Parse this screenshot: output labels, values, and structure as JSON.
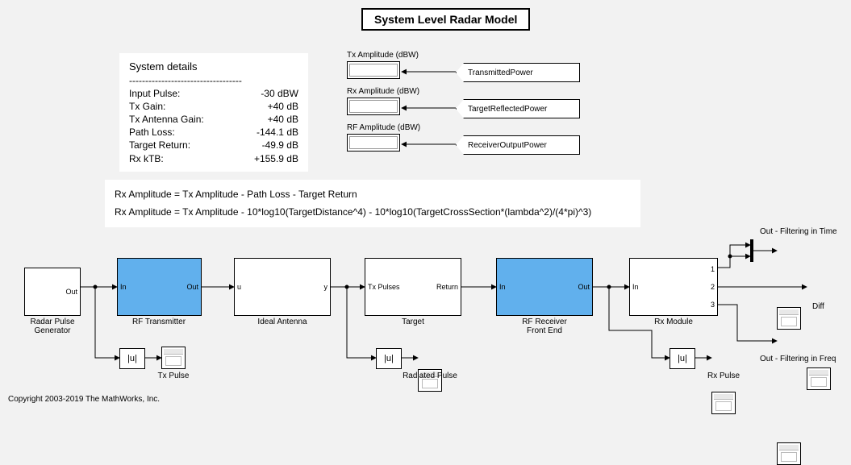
{
  "title": "System Level Radar Model",
  "details": {
    "heading": "System details",
    "dashes": "-----------------------------------",
    "rows": [
      {
        "label": "Input Pulse:",
        "value": "-30 dBW"
      },
      {
        "label": "Tx Gain:",
        "value": "+40 dB"
      },
      {
        "label": "Tx Antenna Gain:",
        "value": "+40 dB"
      },
      {
        "label": "Path Loss:",
        "value": "-144.1 dB"
      },
      {
        "label": "Target Return:",
        "value": "-49.9 dB"
      },
      {
        "label": "Rx kTB:",
        "value": "+155.9 dB"
      }
    ]
  },
  "displays": [
    {
      "label": "Tx Amplitude (dBW)",
      "from": "TransmittedPower"
    },
    {
      "label": "Rx Amplitude (dBW)",
      "from": "TargetReflectedPower"
    },
    {
      "label": "RF Amplitude (dBW)",
      "from": "ReceiverOutputPower"
    }
  ],
  "formulas": {
    "line1": "Rx Amplitude = Tx Amplitude - Path Loss - Target Return",
    "line2": "Rx Amplitude = Tx Amplitude - 10*log10(TargetDistance^4) - 10*log10(TargetCrossSection*(lambda^2)/(4*pi)^3)"
  },
  "blocks": {
    "pulse_gen": {
      "label": "Radar Pulse\nGenerator",
      "ports": {
        "out": "Out"
      }
    },
    "rf_tx": {
      "label": "RF Transmitter",
      "ports": {
        "in": "In",
        "out": "Out"
      }
    },
    "antenna": {
      "label": "Ideal Antenna",
      "ports": {
        "in": "u",
        "out": "y"
      }
    },
    "target": {
      "label": "Target",
      "ports": {
        "in": "Tx Pulses",
        "out": "Return"
      }
    },
    "rf_rx": {
      "label": "RF Receiver\nFront End",
      "ports": {
        "in": "In",
        "out": "Out"
      }
    },
    "rx_module": {
      "label": "Rx Module",
      "ports": {
        "in": "In",
        "out1": "1",
        "out2": "2",
        "out3": "3"
      }
    },
    "abs": "|u|"
  },
  "scopes": {
    "tx_pulse": "Tx Pulse",
    "radiated_pulse": "Radiated Pulse",
    "rx_pulse": "Rx Pulse",
    "out_time": "Out - Filtering in Time",
    "diff": "Diff",
    "out_freq": "Out - Filtering in Freq"
  },
  "copyright": "Copyright 2003-2019 The MathWorks, Inc."
}
